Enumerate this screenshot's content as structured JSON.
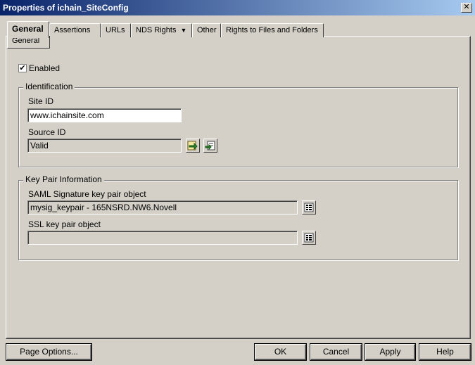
{
  "window": {
    "title": "Properties of ichain_SiteConfig"
  },
  "tabs": [
    {
      "label": "General"
    },
    {
      "label": "Assertions"
    },
    {
      "label": "URLs"
    },
    {
      "label": "NDS Rights"
    },
    {
      "label": "Other"
    },
    {
      "label": "Rights to Files and Folders"
    }
  ],
  "subtab": {
    "label": "General"
  },
  "enabled": {
    "label": "Enabled",
    "checked": true,
    "mark": "✔"
  },
  "identification": {
    "legend": "Identification",
    "site_id_label": "Site ID",
    "site_id_value": "www.ichainsite.com",
    "source_id_label": "Source ID",
    "source_id_value": "Valid"
  },
  "key_pair": {
    "legend": "Key Pair Information",
    "saml_label": "SAML Signature key pair object",
    "saml_value": "mysig_keypair - 165NSRD.NW6.Novell",
    "ssl_label": "SSL key pair object",
    "ssl_value": ""
  },
  "footer": {
    "page_options": "Page Options...",
    "ok": "OK",
    "cancel": "Cancel",
    "apply": "Apply",
    "help": "Help"
  },
  "icons": {
    "close": "close-icon",
    "import": "import-icon",
    "export": "export-icon",
    "browse": "object-browser-icon",
    "dropdown": "chevron-down-icon"
  }
}
